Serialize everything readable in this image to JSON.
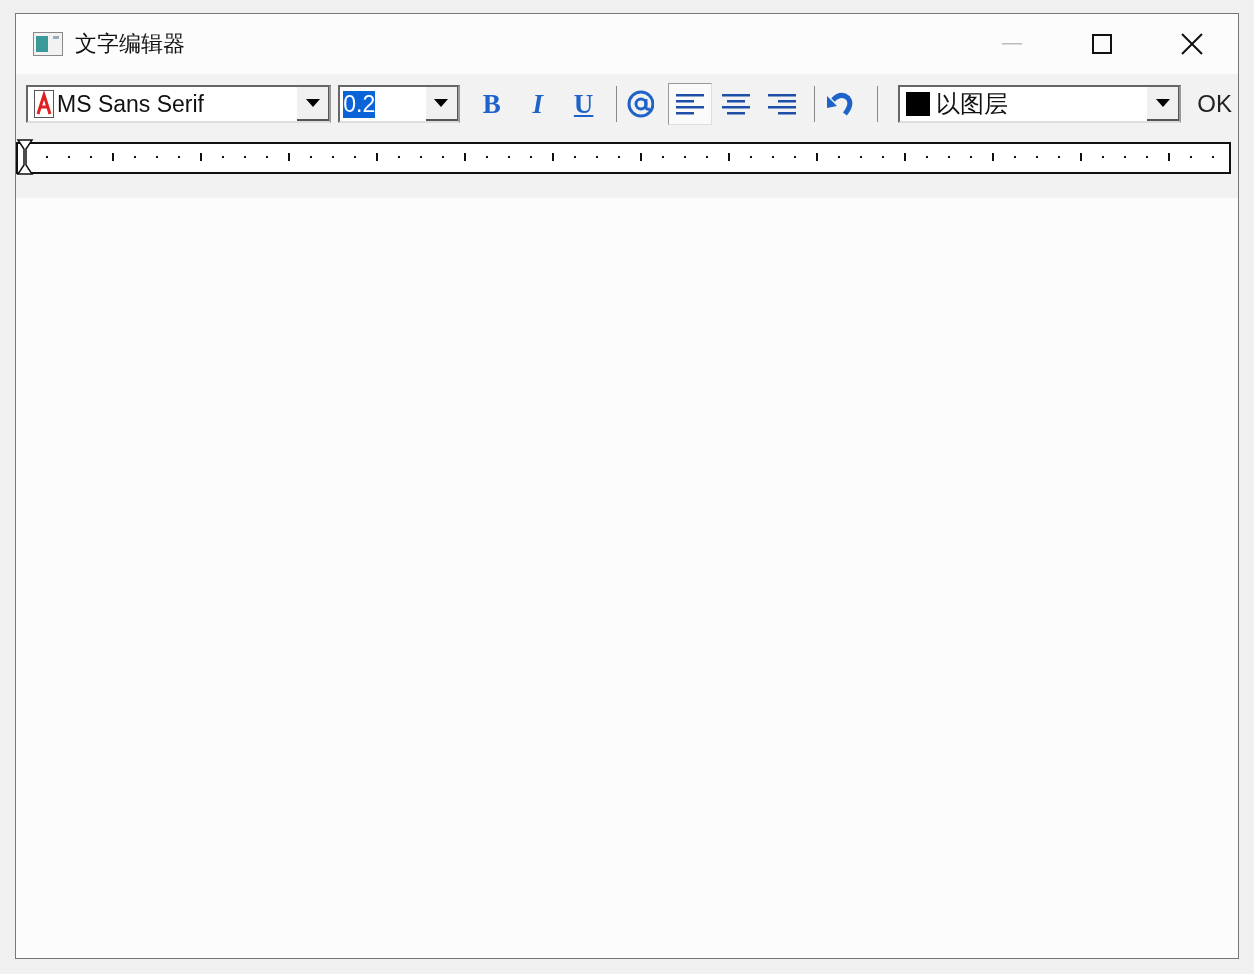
{
  "window": {
    "title": "文字编辑器"
  },
  "toolbar": {
    "font": {
      "value": "MS Sans Serif"
    },
    "size": {
      "value": "0.2",
      "text_selected": true
    },
    "format_buttons": [
      {
        "kind": "bold",
        "label": "B"
      },
      {
        "kind": "italic",
        "label": "I"
      },
      {
        "kind": "underline",
        "label": "U"
      }
    ],
    "align_buttons": [
      {
        "kind": "left",
        "selected": true
      },
      {
        "kind": "center",
        "selected": false
      },
      {
        "kind": "right",
        "selected": false
      }
    ],
    "color": {
      "value": "以图层",
      "color": "#000000"
    },
    "ok": "OK"
  }
}
